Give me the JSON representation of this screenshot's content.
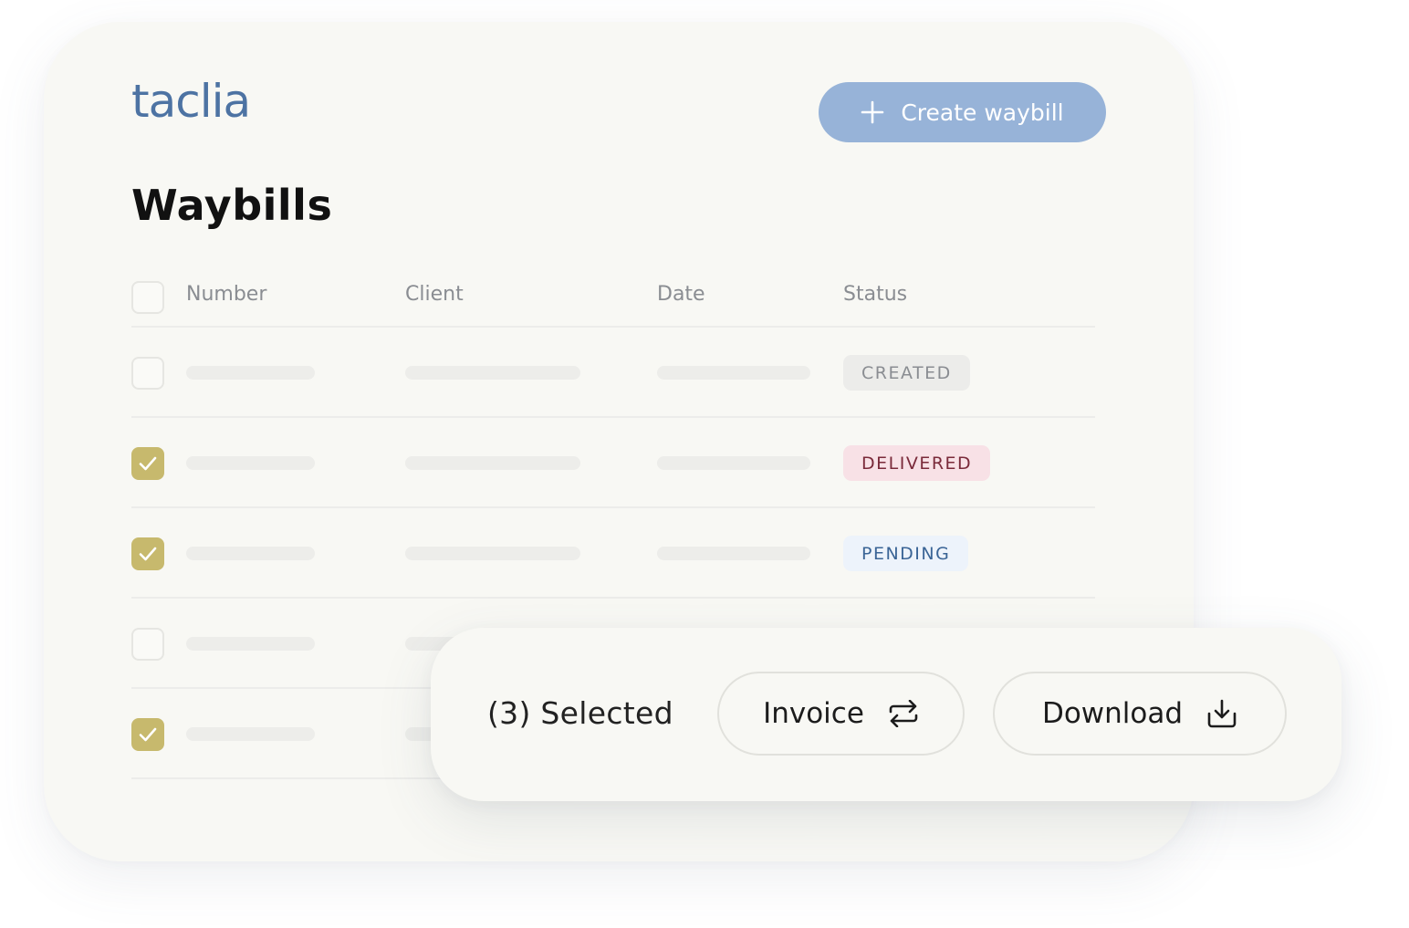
{
  "brand": {
    "logo": "taclia"
  },
  "header": {
    "create_label": "Create waybill"
  },
  "page": {
    "title": "Waybills"
  },
  "table": {
    "columns": [
      "Number",
      "Client",
      "Date",
      "Status"
    ],
    "rows": [
      {
        "checked": false,
        "status": "CREATED",
        "status_bg": "#ececea",
        "status_color": "#8a8d92"
      },
      {
        "checked": true,
        "status": "DELIVERED",
        "status_bg": "#f8e1e6",
        "status_color": "#7a2a3a"
      },
      {
        "checked": true,
        "status": "PENDING",
        "status_bg": "#edf3fb",
        "status_color": "#3a6496"
      },
      {
        "checked": false,
        "status": "",
        "status_bg": "",
        "status_color": ""
      },
      {
        "checked": true,
        "status": "",
        "status_bg": "",
        "status_color": ""
      }
    ]
  },
  "selection": {
    "label": "(3) Selected",
    "invoice_label": "Invoice",
    "download_label": "Download"
  },
  "icons": {
    "create": "plus-icon",
    "invoice": "swap-arrows-icon",
    "download": "download-tray-icon",
    "check": "check-icon"
  },
  "colors": {
    "brand_blue": "#4d73a3",
    "button_blue": "#97b3d8",
    "checkbox_gold": "#c7b96d",
    "card_bg": "#f8f8f4"
  }
}
